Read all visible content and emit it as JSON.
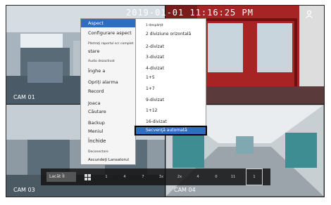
{
  "clock": {
    "text": "2019-01-01 11:16:25 PM"
  },
  "panes": [
    {
      "label": "CAM 01"
    },
    {
      "label": ""
    },
    {
      "label": "CAM 03"
    },
    {
      "label": "CAM 04"
    }
  ],
  "main_menu": {
    "items": [
      "Aspect",
      "Configurare aspect",
      "Păstraţi raportul scr complet",
      "stare",
      "Audio dezactivat",
      "Înghe a",
      "Opriți alarma",
      "Record",
      "Joaca",
      "Căutare",
      "Backup",
      "Meniul",
      "Închide",
      "Deconectare",
      "Ascundeţi Lansatorul"
    ]
  },
  "sub_menu": {
    "items": [
      "1-despărţit",
      "2 diviziune orizontală",
      "2-divizat",
      "3-divizat",
      "4-divizat",
      "1+5",
      "1+7",
      "9-divizat",
      "1+12",
      "16-divizat",
      "Secvenţă automată"
    ]
  },
  "toolbar": {
    "lock_label": "Lacăt ÎI",
    "buttons": [
      "1",
      "4",
      "7",
      "3x",
      "2x",
      "4",
      "0",
      "11",
      "1"
    ]
  },
  "colors": {
    "highlight": "#2d6ec4"
  }
}
